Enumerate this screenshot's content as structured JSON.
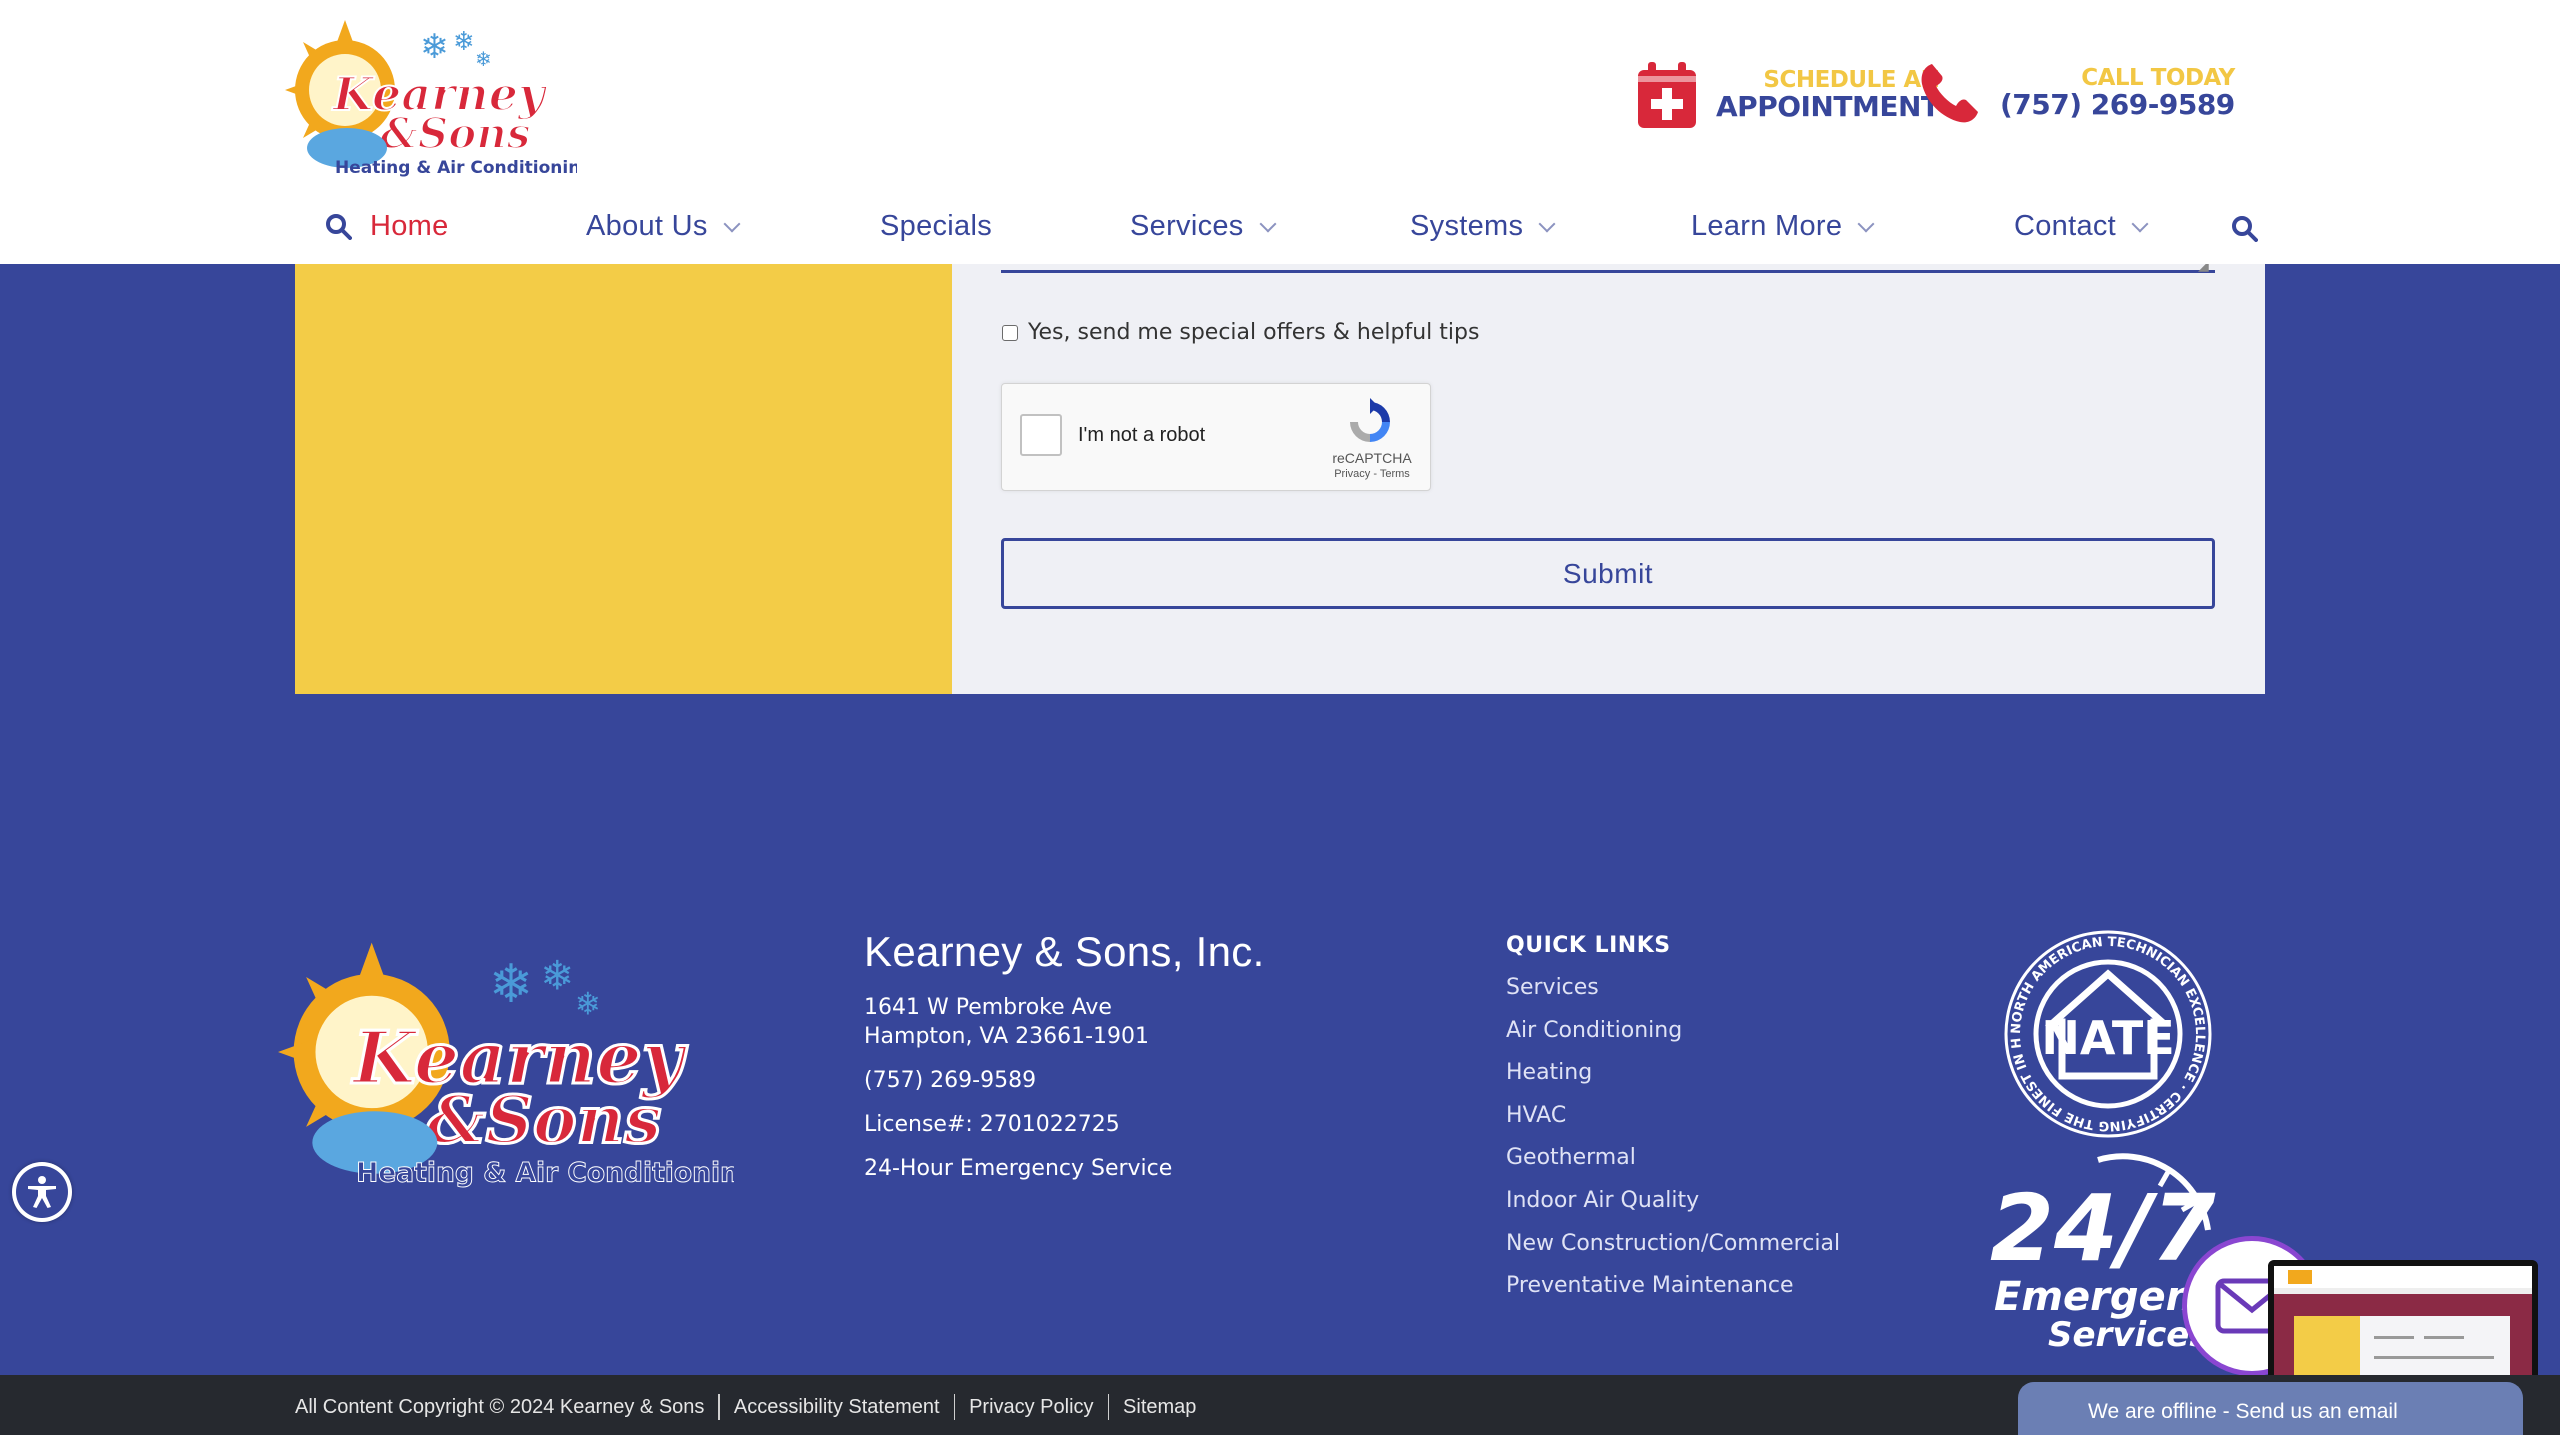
{
  "header": {
    "logo_alt": "Kearney & Sons Inc Heating & Air Conditioning",
    "appointment_top": "SCHEDULE AN",
    "appointment_bottom": "APPOINTMENT",
    "call_top": "CALL TODAY",
    "call_bottom": "(757) 269-9589"
  },
  "nav": {
    "items": [
      {
        "label": "Home"
      },
      {
        "label": "About Us"
      },
      {
        "label": "Specials"
      },
      {
        "label": "Services"
      },
      {
        "label": "Systems"
      },
      {
        "label": "Learn More"
      },
      {
        "label": "Contact"
      }
    ]
  },
  "form": {
    "optin_label": "Yes, send me special offers & helpful tips",
    "recaptcha_label": "I'm not a robot",
    "recaptcha_brand": "reCAPTCHA",
    "recaptcha_links": "Privacy - Terms",
    "submit_label": "Submit"
  },
  "footer": {
    "company": "Kearney & Sons, Inc.",
    "address_line1": "1641 W Pembroke Ave",
    "address_line2": "Hampton, VA 23661-1901",
    "phone": "(757) 269-9589",
    "license": "License#: 2701022725",
    "emergency": "24-Hour Emergency Service",
    "quick_links_heading": "QUICK LINKS",
    "quick_links": [
      "Services",
      "Air Conditioning",
      "Heating",
      "HVAC",
      "Geothermal",
      "Indoor Air Quality",
      "New Construction/Commercial",
      "Preventative Maintenance"
    ],
    "nate_text": "NATE",
    "nate_ring": "NORTH AMERICAN TECHNICIAN EXCELLENCE · CERTIFYING THE FINEST IN HVACR",
    "badge_247": "24/7",
    "badge_emergency": "Emergency",
    "badge_services": "Services"
  },
  "bottom_bar": {
    "copyright": "All Content Copyright © 2024 Kearney & Sons",
    "links": [
      "Accessibility Statement",
      "Privacy Policy",
      "Sitemap"
    ]
  },
  "chat": {
    "status": "We are offline - Send us an email"
  },
  "colors": {
    "brand_blue": "#37469a",
    "brand_yellow": "#f3cc47",
    "brand_red": "#d8283a",
    "bottom_bar": "#26292f"
  }
}
